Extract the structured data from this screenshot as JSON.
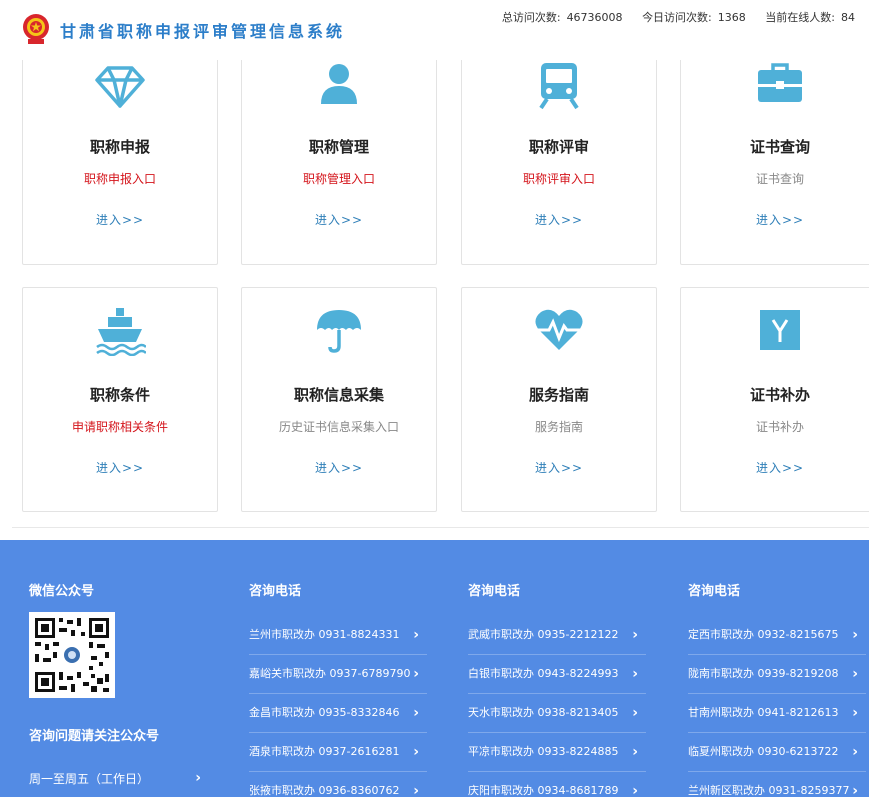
{
  "header": {
    "site_title": "甘肃省职称申报评审管理信息系统",
    "stats": [
      {
        "label": "总访问次数:",
        "value": "46736008"
      },
      {
        "label": "今日访问次数:",
        "value": "1368"
      },
      {
        "label": "当前在线人数:",
        "value": "84"
      }
    ]
  },
  "cards": [
    {
      "title": "职称申报",
      "subtitle": "职称申报入口",
      "go": "进入>>",
      "icon": "diamond-icon"
    },
    {
      "title": "职称管理",
      "subtitle": "职称管理入口",
      "go": "进入>>",
      "icon": "user-icon"
    },
    {
      "title": "职称评审",
      "subtitle": "职称评审入口",
      "go": "进入>>",
      "icon": "train-icon"
    },
    {
      "title": "证书查询",
      "subtitle": "证书查询",
      "go": "进入>>",
      "icon": "briefcase-icon"
    },
    {
      "title": "职称条件",
      "subtitle": "申请职称相关条件",
      "go": "进入>>",
      "icon": "ship-icon"
    },
    {
      "title": "职称信息采集",
      "subtitle": "历史证书信息采集入口",
      "go": "进入>>",
      "icon": "umbrella-icon"
    },
    {
      "title": "服务指南",
      "subtitle": "服务指南",
      "go": "进入>>",
      "icon": "heartbeat-icon"
    },
    {
      "title": "证书补办",
      "subtitle": "证书补办",
      "go": "进入>>",
      "icon": "yen-icon"
    }
  ],
  "footer": {
    "wechat_heading": "微信公众号",
    "follow_text": "咨询问题请关注公众号",
    "workday_text": "周一至周五（工作日）",
    "consult_heading": "咨询电话",
    "col1": [
      "兰州市职改办 0931-8824331",
      "嘉峪关市职改办 0937-6789790",
      "金昌市职改办 0935-8332846",
      "酒泉市职改办 0937-2616281",
      "张掖市职改办 0936-8360762"
    ],
    "col2": [
      "武威市职改办 0935-2212122",
      "白银市职改办 0943-8224993",
      "天水市职改办 0938-8213405",
      "平凉市职改办 0933-8224885",
      "庆阳市职改办 0934-8681789"
    ],
    "col3": [
      "定西市职改办 0932-8215675",
      "陇南市职改办 0939-8219208",
      "甘南州职改办 0941-8212613",
      "临夏州职改办 0930-6213722",
      "兰州新区职改办 0931-8259377"
    ]
  },
  "colors": {
    "accent_blue": "#538be4",
    "icon_blue": "#4fb0d8",
    "link_red": "#d4141b",
    "link_blue": "#2f7fb8"
  }
}
